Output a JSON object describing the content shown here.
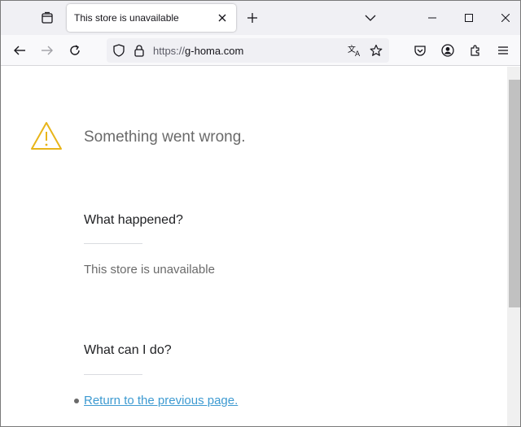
{
  "browser": {
    "tab": {
      "title": "This store is unavailable"
    },
    "url": {
      "scheme": "https://",
      "host": "g-homa.com"
    }
  },
  "page": {
    "headline": "Something went wrong.",
    "what_happened": {
      "heading": "What happened?",
      "text": "This store is unavailable"
    },
    "what_can_i_do": {
      "heading": "What can I do?",
      "link_text": "Return to the previous page."
    }
  },
  "colors": {
    "warning": "#e8b51a",
    "link": "#3d9ad1"
  }
}
